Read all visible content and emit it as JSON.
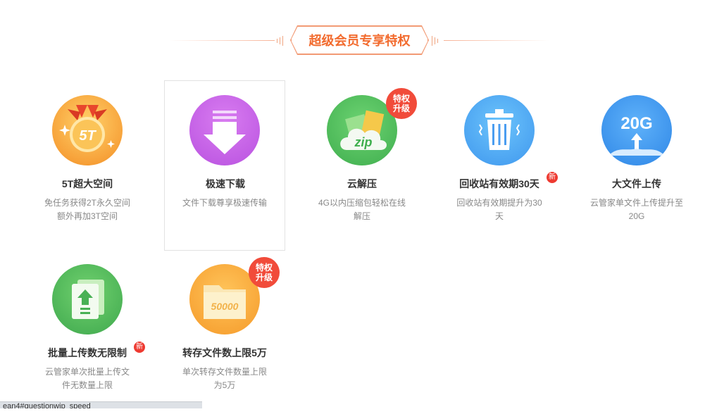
{
  "header": {
    "title": "超级会员专享特权"
  },
  "cards": [
    {
      "icon": "5t-storage-icon",
      "title": "5T超大空间",
      "desc": "免任务获得2T永久空间额外再加3T空间",
      "icon_text": "5T"
    },
    {
      "icon": "fast-download-icon",
      "title": "极速下载",
      "desc": "文件下载尊享极速传输"
    },
    {
      "icon": "cloud-zip-icon",
      "title": "云解压",
      "desc": "4G以内压缩包轻松在线解压",
      "icon_text": "zip",
      "corner_badge": "特权升级"
    },
    {
      "icon": "recycle-bin-icon",
      "title": "回收站有效期30天",
      "desc": "回收站有效期提升为30天",
      "new_badge": "新"
    },
    {
      "icon": "large-file-upload-icon",
      "title": "大文件上传",
      "desc": "云管家单文件上传提升至20G",
      "icon_text": "20G"
    },
    {
      "icon": "batch-upload-icon",
      "title": "批量上传数无限制",
      "desc": "云管家单次批量上传文件无数量上限",
      "new_badge": "新"
    },
    {
      "icon": "transfer-folder-icon",
      "title": "转存文件数上限5万",
      "desc": "单次转存文件数量上限为5万",
      "icon_text": "50000",
      "corner_badge": "特权升级"
    }
  ],
  "colors": {
    "accent": "#f26b2e",
    "badge_red": "#f14b3a",
    "orange": "#f7a23a",
    "purple": "#c45ce6",
    "green": "#4cb85a",
    "blue": "#4a9df0"
  },
  "status_bar": {
    "text": "ean4#questionwip_speed"
  }
}
